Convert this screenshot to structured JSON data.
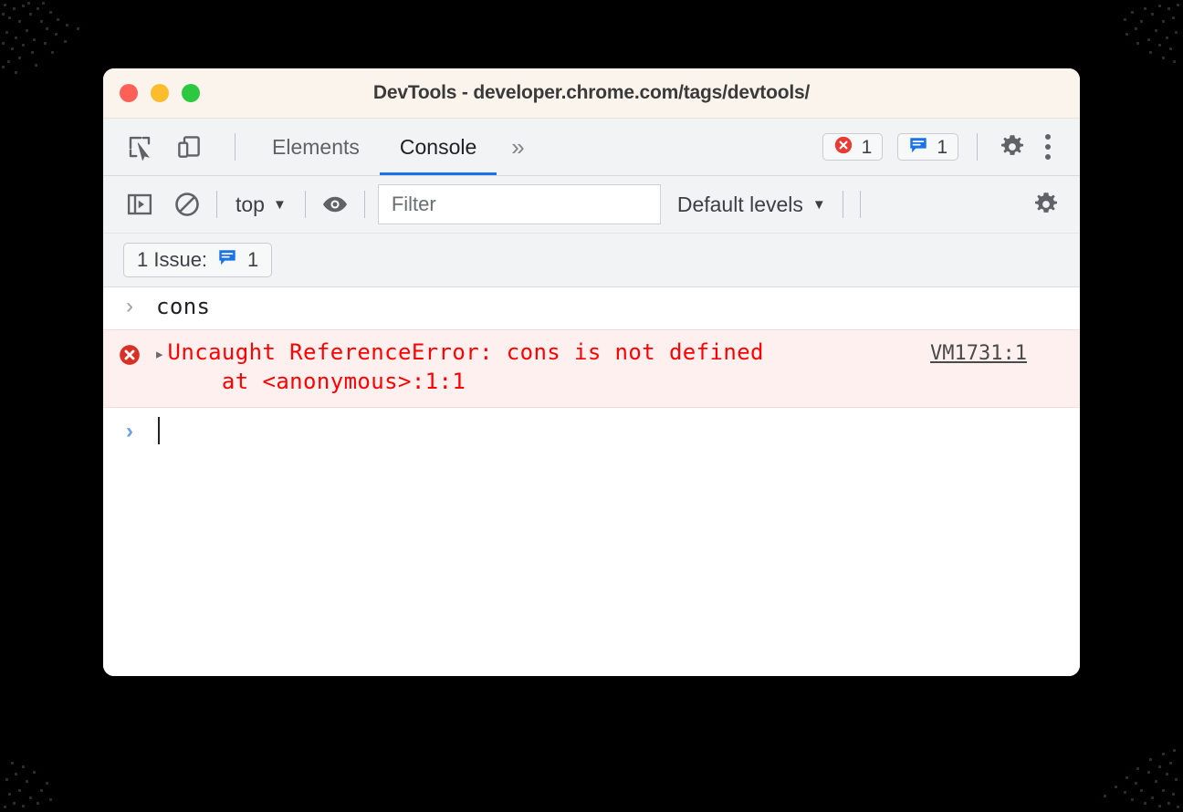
{
  "window": {
    "title": "DevTools - developer.chrome.com/tags/devtools/",
    "traffic_lights": {
      "close": "close-window",
      "minimize": "minimize-window",
      "maximize": "maximize-window"
    },
    "colors": {
      "titlebar_bg": "#faf4ec",
      "toolbar_bg": "#f1f3f4",
      "accent_blue": "#1a73e8",
      "error_red": "#ff0000",
      "error_row_bg": "#fff0f0",
      "issue_blue": "#1a73e8",
      "traffic_red": "#ff6159",
      "traffic_yellow": "#fbbd2e",
      "traffic_green": "#2bc840"
    }
  },
  "tabbar": {
    "inspect_icon": "inspect-element-icon",
    "device_icon": "device-toolbar-icon",
    "tabs": [
      {
        "label": "Elements",
        "active": false
      },
      {
        "label": "Console",
        "active": true
      }
    ],
    "more_tabs_label": "»",
    "error_badge": {
      "icon": "error-circle-icon",
      "count": "1"
    },
    "issues_badge": {
      "icon": "issues-speech-bubble-icon",
      "count": "1"
    },
    "settings_icon": "gear-icon",
    "menu_icon": "three-dot-menu-icon"
  },
  "console_toolbar": {
    "sidebar_icon": "console-sidebar-toggle-icon",
    "clear_icon": "clear-console-icon",
    "context_label": "top",
    "context_caret": "▼",
    "eye_icon": "live-expression-eye-icon",
    "filter_placeholder": "Filter",
    "filter_value": "",
    "levels_label": "Default levels",
    "levels_caret": "▼",
    "settings_icon": "console-settings-gear-icon"
  },
  "issues_bar": {
    "label": "1 Issue:",
    "icon": "issues-speech-bubble-icon",
    "count": "1"
  },
  "console": {
    "command": {
      "prompt": "›",
      "text": "cons"
    },
    "error": {
      "icon": "error-circle-icon",
      "expand_arrow": "▸",
      "line1": "Uncaught ReferenceError: cons is not defined",
      "line2": "    at <anonymous>:1:1",
      "source_link": "VM1731:1"
    },
    "input": {
      "prompt": "›",
      "value": ""
    }
  }
}
